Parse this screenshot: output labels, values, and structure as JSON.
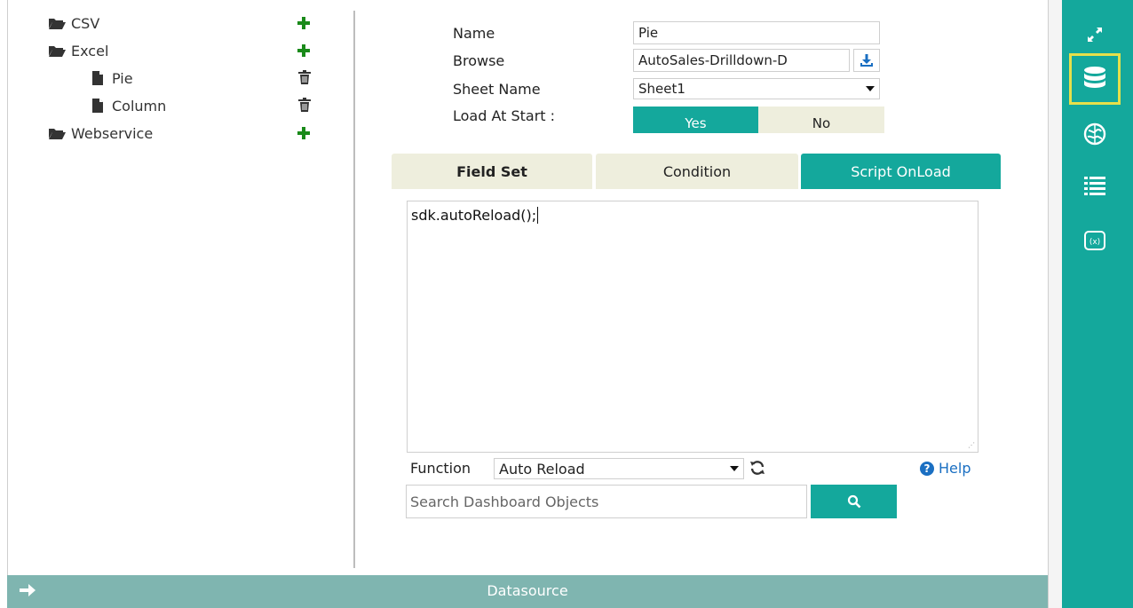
{
  "tree": {
    "csv": "CSV",
    "excel": "Excel",
    "pie": "Pie",
    "column": "Column",
    "webservice": "Webservice"
  },
  "form": {
    "name_label": "Name",
    "name_value": "Pie",
    "browse_label": "Browse",
    "browse_value": "AutoSales-Drilldown-D",
    "sheet_label": "Sheet Name",
    "sheet_value": "Sheet1",
    "load_label": "Load At Start :",
    "yes_label": "Yes",
    "no_label": "No"
  },
  "tabs": [
    {
      "label": "Field Set"
    },
    {
      "label": "Condition"
    },
    {
      "label": "Script OnLoad"
    }
  ],
  "script": {
    "content": "sdk.autoReload();"
  },
  "function_bar": {
    "label": "Function",
    "selected": "Auto Reload",
    "help_label": "Help"
  },
  "search": {
    "placeholder": "Search Dashboard Objects"
  },
  "bottom_bar": {
    "title": "Datasource"
  },
  "colors": {
    "accent": "#14a89c",
    "tab_inactive": "#eeeedd",
    "bottom_bar": "#7fb5b0",
    "add_green": "#1a8a1a",
    "help_blue": "#1a6fc2",
    "selected_outline": "#e6e04a"
  },
  "icons": {
    "folder": "folder-open-icon",
    "file": "file-icon",
    "add": "plus-icon",
    "delete": "trash-icon",
    "download": "download-icon",
    "refresh": "refresh-icon",
    "search": "search-icon",
    "help": "question-circle-icon",
    "rail": [
      "expand-icon",
      "database-icon",
      "globe-icon",
      "list-icon",
      "formula-icon"
    ]
  }
}
